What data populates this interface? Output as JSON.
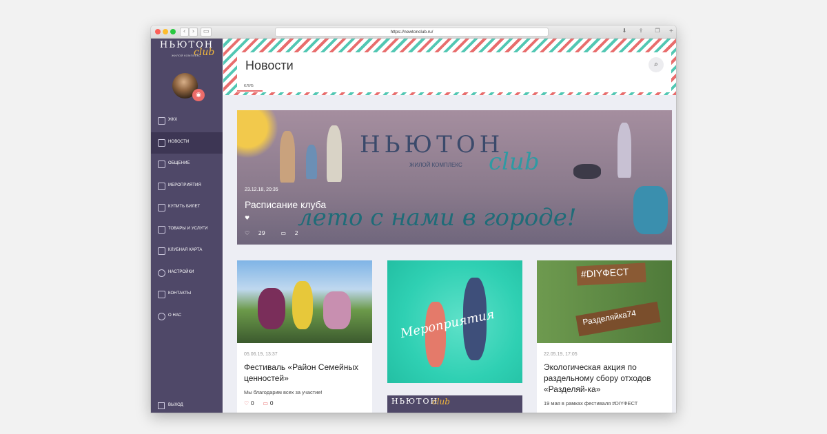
{
  "browser": {
    "url": "https://newtonclub.ru/",
    "back_icon": "chevron-left-icon",
    "forward_icon": "chevron-right-icon"
  },
  "sidebar": {
    "logo_text": "НЬЮТОН",
    "logo_club": "club",
    "logo_subtitle": "ЖИЛОЙ КОМПЛЕКС",
    "items": [
      {
        "label": "ЖКХ",
        "icon": "home-icon"
      },
      {
        "label": "Новости",
        "icon": "news-icon"
      },
      {
        "label": "Общение",
        "icon": "chat-icon"
      },
      {
        "label": "Мероприятия",
        "icon": "calendar-icon"
      },
      {
        "label": "Купить билет",
        "icon": "ticket-icon"
      },
      {
        "label": "Товары и услуги",
        "icon": "shop-icon"
      },
      {
        "label": "Клубная карта",
        "icon": "card-icon"
      },
      {
        "label": "Настройки",
        "icon": "gear-icon"
      },
      {
        "label": "Контакты",
        "icon": "mail-icon"
      },
      {
        "label": "О нас",
        "icon": "info-icon"
      }
    ],
    "active_index": 1,
    "logout_label": "Выход"
  },
  "header": {
    "title": "Новости",
    "tab": "Клуб"
  },
  "hero": {
    "brand": "НЬЮТОН",
    "brand_sub": "ЖИЛОЙ КОМПЛЕКС",
    "brand_club": "club",
    "slogan": "лето с нами в городе!",
    "date": "23.12.18, 20:35",
    "title": "Расписание клуба",
    "small_heart": "♥",
    "likes": "29",
    "comments": "2"
  },
  "cards": [
    {
      "date": "05.06.19, 13:37",
      "title": "Фестиваль «Район Семейных ценностей»",
      "excerpt": "Мы благодарим всех за участие!",
      "likes": "0",
      "comments": "0"
    },
    {
      "image_text": "Мероприятия"
    },
    {
      "date": "22.05.19, 17:05",
      "title": "Экологическая акция по раздельному сбору отходов «Разделяй-ка»",
      "excerpt": "19 мая в рамках фестиваля #DIYФЕСТ",
      "sign1": "#DIYФЕСТ",
      "sign2": "Разделяйка74"
    }
  ],
  "colors": {
    "sidebar": "#4f4868",
    "accent": "#e86d6d",
    "teal": "#52c7b3"
  }
}
